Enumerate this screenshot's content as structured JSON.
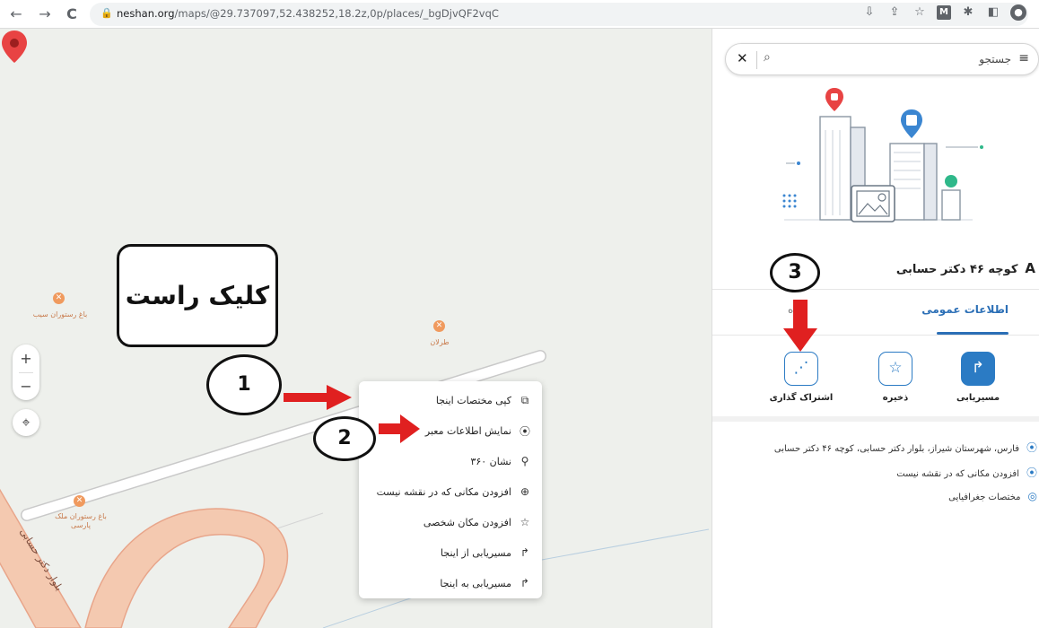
{
  "browser": {
    "url_domain": "neshan.org",
    "url_path": "/maps/@29.737097,52.438252,18.2z,0p/places/_bgDjvQF2vqC",
    "nav": {
      "back": "←",
      "forward": "→",
      "reload": "C"
    },
    "lock_icon": "🔒",
    "toolbar_icons": {
      "install": "⇩",
      "share": "⇪",
      "star": "☆",
      "gmail": "M",
      "extensions": "✱",
      "sidepanel": "◧",
      "profile": "●"
    }
  },
  "map": {
    "zoom_in": "+",
    "zoom_out": "−",
    "locate_icon": "⌖",
    "pois": [
      {
        "label": "باغ رستوران سیب"
      },
      {
        "label": "طرلان"
      },
      {
        "label": "باغ رستوران ملک پارسی"
      }
    ],
    "street_label": "بلوار دکتر حسابی",
    "context_menu": [
      {
        "label": "کپی مختصات اینجا",
        "icon": "⧉"
      },
      {
        "label": "نمایش اطلاعات معبر",
        "icon": "⦿"
      },
      {
        "label": "نشان ۳۶۰",
        "icon": "⚲"
      },
      {
        "label": "افزودن مکانی که در نقشه نیست",
        "icon": "⊕"
      },
      {
        "label": "افزودن مکان شخصی",
        "icon": "☆"
      },
      {
        "label": "مسیریابی از اینجا",
        "icon": "↱"
      },
      {
        "label": "مسیریابی به اینجا",
        "icon": "↱"
      }
    ],
    "annotations": {
      "callout": "کلیک راست",
      "step1": "1",
      "step2": "2",
      "step3": "3"
    }
  },
  "panel": {
    "search_placeholder": "جستجو",
    "menu_icon": "≡",
    "close_icon": "✕",
    "search_icon": "⌕",
    "place_title": "کوچه ۴۶ دکتر حسابی",
    "place_title_icon": "A",
    "tabs": {
      "general": "اطلاعات عمومی",
      "other_partial": "ه"
    },
    "actions": [
      {
        "label": "مسیریابی",
        "icon": "↱"
      },
      {
        "label": "ذخیره",
        "icon": "☆"
      },
      {
        "label": "اشتراک گذاری",
        "icon": "⋰"
      }
    ],
    "info_rows": [
      {
        "text": "فارس، شهرستان شیراز، بلوار دکتر حسابی، کوچه ۴۶ دکتر حسابی",
        "icon": "⦿"
      },
      {
        "text": "افزودن مکانی که در نقشه نیست",
        "icon": "⦿"
      },
      {
        "text": "مختصات جغرافیایی",
        "icon": "◎"
      }
    ]
  },
  "colors": {
    "accent": "#2b7bc4",
    "annotation_red": "#e02020",
    "pin_red": "#e84343",
    "road_fill": "#f4c9b0",
    "road_border": "#e8a58a"
  }
}
